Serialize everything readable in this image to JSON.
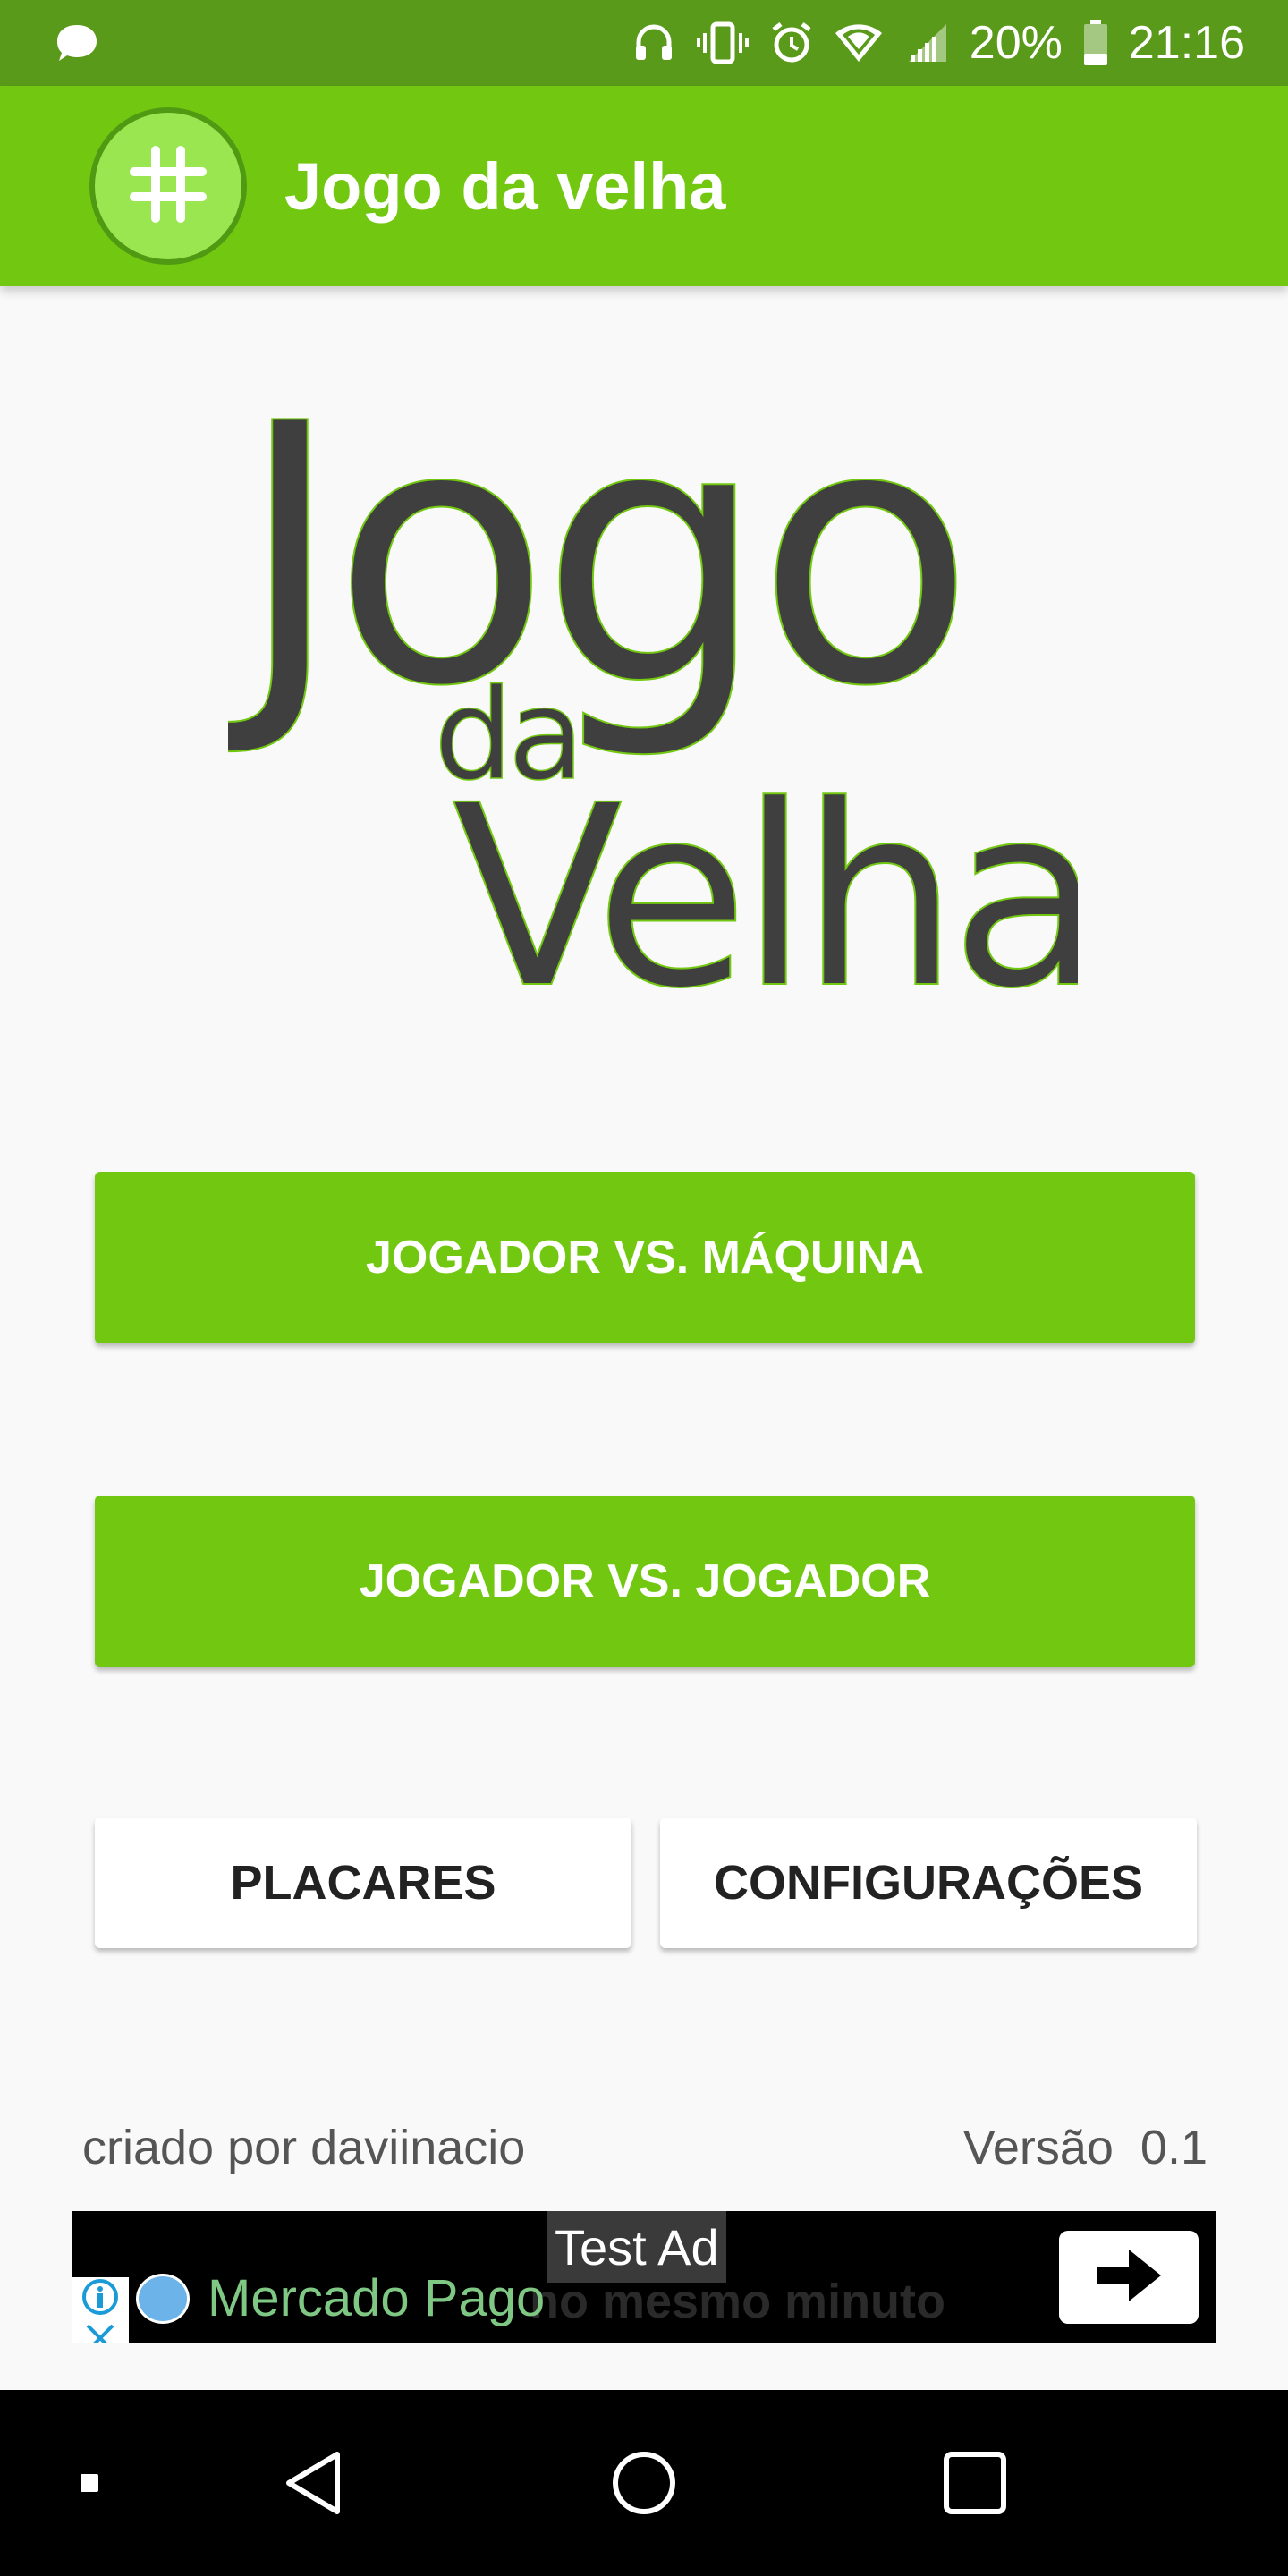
{
  "status_bar": {
    "notification_icon": "chat-bubble-icon",
    "icons": [
      "headphones-icon",
      "vibrate-icon",
      "alarm-icon",
      "wifi-icon",
      "signal-icon"
    ],
    "battery_percent": "20%",
    "time": "21:16"
  },
  "app_bar": {
    "logo_icon": "hash-icon",
    "title": "Jogo da velha"
  },
  "logo": {
    "line1": "Jogo",
    "line2": "da",
    "line3": "Velha"
  },
  "buttons": {
    "player_vs_machine": "JOGADOR VS. MÁQUINA",
    "player_vs_player": "JOGADOR VS. JOGADOR",
    "scores": "PLACARES",
    "settings": "CONFIGURAÇÕES"
  },
  "footer": {
    "credit": "criado por daviinacio",
    "version_label": "Versão",
    "version_value": "0.1"
  },
  "ad": {
    "label": "Test Ad",
    "brand": "Mercado Pago",
    "tagline": "no mesmo minuto",
    "info_icon": "info-icon",
    "close_icon": "close-icon",
    "cta_icon": "arrow-right-icon"
  },
  "nav_bar": {
    "items": [
      "recents-dot-icon",
      "back-icon",
      "home-icon",
      "overview-icon"
    ]
  },
  "colors": {
    "status_bar": "#5a9a1a",
    "accent": "#72c811",
    "logo_text": "#3f3f3f",
    "background": "#f9f9f9"
  }
}
